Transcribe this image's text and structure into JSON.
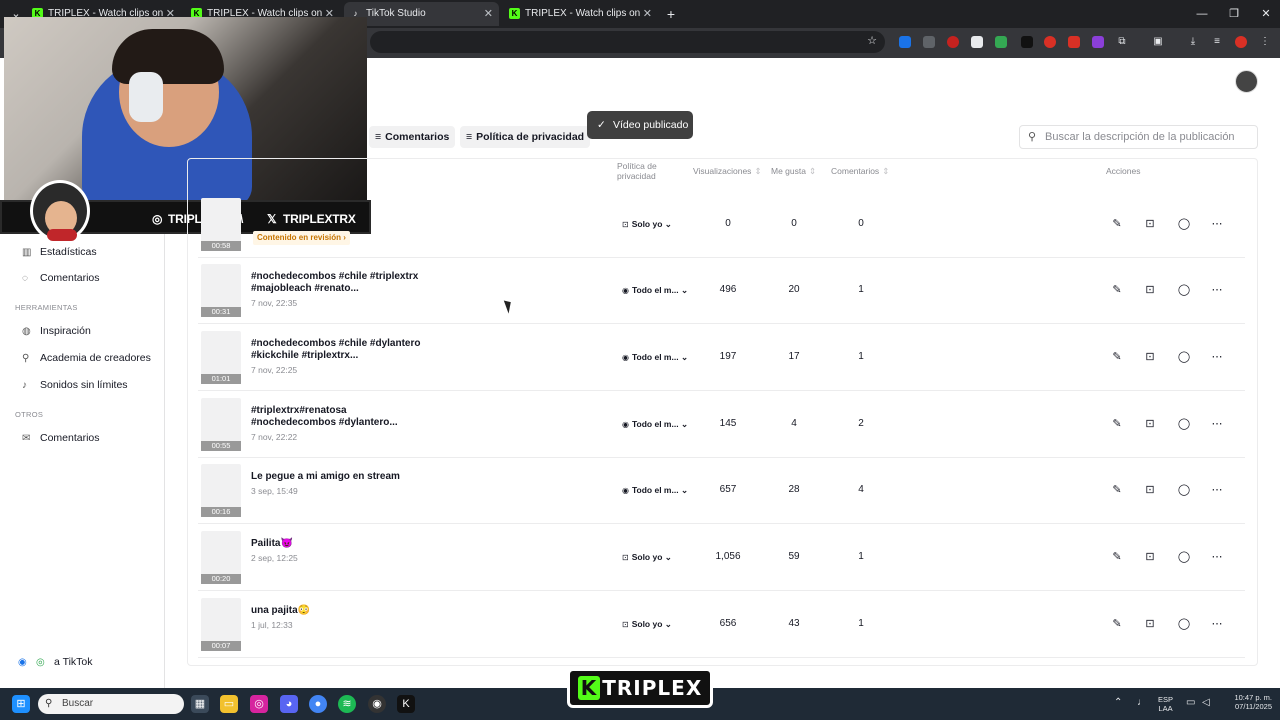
{
  "browser": {
    "tabs": [
      {
        "title": "TRIPLEX - Watch clips on Kick",
        "favicon": "kick-icon",
        "active": false
      },
      {
        "title": "TRIPLEX - Watch clips on Kick",
        "favicon": "kick-icon",
        "active": false
      },
      {
        "title": "TikTok Studio",
        "favicon": "tiktok-icon",
        "active": true
      },
      {
        "title": "TRIPLEX - Watch clips on Kick",
        "favicon": "kick-icon",
        "active": false
      }
    ],
    "new_tab": "+",
    "close": "✕"
  },
  "overlay": {
    "instagram": "TRIPLEXTRX",
    "separator": "\\",
    "x_handle": "TRIPLEXTRX",
    "logo": "TRIPLEX",
    "logo_k": "K"
  },
  "sidebar": {
    "items_top": [
      {
        "label": "Estadísticas",
        "icon": "chart-icon"
      },
      {
        "label": "Comentarios",
        "icon": "comment-icon"
      }
    ],
    "section_tools": "HERRAMIENTAS",
    "tools": [
      {
        "label": "Inspiración",
        "icon": "bulb-icon"
      },
      {
        "label": "Academia de creadores",
        "icon": "academy-icon"
      },
      {
        "label": "Sonidos sin límites",
        "icon": "music-icon"
      }
    ],
    "section_other": "OTROS",
    "other": [
      {
        "label": "Comentarios",
        "icon": "mail-icon"
      }
    ],
    "footer": "a TikTok"
  },
  "filters": {
    "comments": "Comentarios",
    "privacy": "Política de privacidad"
  },
  "toast": "Vídeo publicado",
  "search": {
    "placeholder": "Buscar la descripción de la publicación"
  },
  "table": {
    "headers": {
      "privacy": "Política de privacidad",
      "views": "Visualizaciones",
      "likes": "Me gusta",
      "comments": "Comentarios",
      "actions": "Acciones"
    },
    "review_badge": "Contenido en revisión ›",
    "rows": [
      {
        "title": "",
        "date": "",
        "duration": "00:58",
        "privacy": "Solo yo",
        "views": "0",
        "likes": "0",
        "comments": "0"
      },
      {
        "title": "#nochedecombos #chile #triplextrx #majobleach #renato...",
        "date": "7 nov, 22:35",
        "duration": "00:31",
        "privacy": "Todo el m...",
        "views": "496",
        "likes": "20",
        "comments": "1"
      },
      {
        "title": "#nochedecombos #chile #dylantero #kickchile #triplextrx...",
        "date": "7 nov, 22:25",
        "duration": "01:01",
        "privacy": "Todo el m...",
        "views": "197",
        "likes": "17",
        "comments": "1"
      },
      {
        "title": "#triplextrx#renatosa #nochedecombos #dylantero...",
        "date": "7 nov, 22:22",
        "duration": "00:55",
        "privacy": "Todo el m...",
        "views": "145",
        "likes": "4",
        "comments": "2"
      },
      {
        "title": "Le pegue a mi amigo en stream",
        "date": "3 sep, 15:49",
        "duration": "00:16",
        "privacy": "Todo el m...",
        "views": "657",
        "likes": "28",
        "comments": "4"
      },
      {
        "title": "Pailita😈",
        "date": "2 sep, 12:25",
        "duration": "00:20",
        "privacy": "Solo yo",
        "views": "1,056",
        "likes": "59",
        "comments": "1"
      },
      {
        "title": "una pajita😳",
        "date": "1 jul, 12:33",
        "duration": "00:07",
        "privacy": "Solo yo",
        "views": "656",
        "likes": "43",
        "comments": "1"
      }
    ]
  },
  "taskbar": {
    "search": "Buscar",
    "lang": "ESP",
    "region": "LAA",
    "time": "10:47 p. m.",
    "date": "07/11/2025"
  },
  "colors": {
    "kick_green": "#53fc18",
    "chrome_dark": "#202124",
    "accent": "#fe2c55"
  }
}
